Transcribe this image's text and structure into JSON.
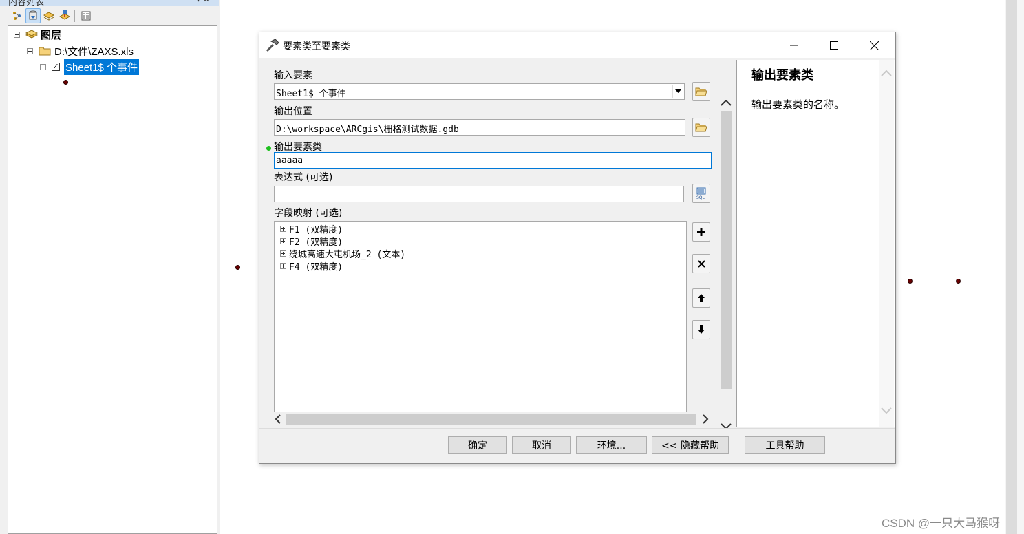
{
  "toc": {
    "title": "内容列表",
    "toolbar_icons": [
      "list-by-drawing-order-icon",
      "list-by-source-icon",
      "list-by-visibility-icon",
      "list-by-selection-icon",
      "options-icon"
    ],
    "tree": {
      "root_label": "图层",
      "folder_label": "D:\\文件\\ZAXS.xls",
      "layer_label": "Sheet1$ 个事件",
      "layer_checked": "✓"
    }
  },
  "dialog": {
    "title": "要素类至要素类",
    "fields": {
      "input_features_label": "输入要素",
      "input_features_value": "Sheet1$ 个事件",
      "output_location_label": "输出位置",
      "output_location_value": "D:\\workspace\\ARCgis\\栅格测试数据.gdb",
      "output_fc_label": "输出要素类",
      "output_fc_value": "aaaaa",
      "expression_label": "表达式 (可选)",
      "expression_value": "",
      "field_map_label": "字段映射 (可选)"
    },
    "field_map": [
      "F1 (双精度)",
      "F2 (双精度)",
      "绕城高速大屯机场_2 (文本)",
      "F4 (双精度)"
    ],
    "help": {
      "title": "输出要素类",
      "body": "输出要素类的名称。"
    },
    "buttons": {
      "ok": "确定",
      "cancel": "取消",
      "environments": "环境...",
      "hide_help": "<< 隐藏帮助",
      "tool_help": "工具帮助"
    }
  },
  "watermark": "CSDN @一只大马猴呀",
  "colors": {
    "selection": "#0078d7",
    "point_symbol": "#6b0000",
    "required_dot": "#1fc01f"
  }
}
